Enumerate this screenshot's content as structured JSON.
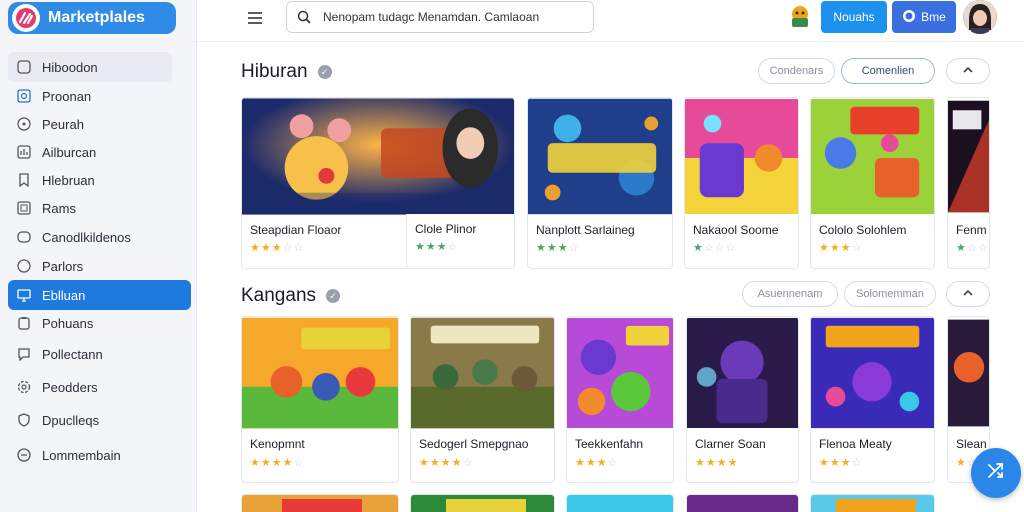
{
  "app": {
    "title": "Marketplales"
  },
  "search": {
    "value": "Nenopam tudagc Menamdan. Camlaoan"
  },
  "header": {
    "notif_label": "Nouahs",
    "user_label": "Bme"
  },
  "sidebar": {
    "items": [
      {
        "label": "Hiboodon",
        "icon": "sliders-icon"
      },
      {
        "label": "Proonan",
        "icon": "box-icon"
      },
      {
        "label": "Peurah",
        "icon": "circle-icon"
      },
      {
        "label": "Ailburcan",
        "icon": "bars-icon"
      },
      {
        "label": "Hlebruan",
        "icon": "bookmark-icon"
      },
      {
        "label": "Rams",
        "icon": "square-icon"
      },
      {
        "label": "Canodlkildenos",
        "icon": "cube-icon"
      },
      {
        "label": "Parlors",
        "icon": "ring-icon"
      },
      {
        "label": "Eblluan",
        "icon": "monitor-icon",
        "active": true
      },
      {
        "label": "Pohuans",
        "icon": "clipboard-icon"
      },
      {
        "label": "Pollectann",
        "icon": "chat-icon"
      },
      {
        "label": "Peodders",
        "icon": "gear-icon"
      },
      {
        "label": "Dpuclleqs",
        "icon": "shield-icon"
      },
      {
        "label": "Lommembain",
        "icon": "minus-circle-icon"
      }
    ]
  },
  "sections": [
    {
      "title": "Hiburan",
      "filter1": "Condenars",
      "filter2": "Comenlien",
      "cards": [
        {
          "name": "Steapdian Floaor",
          "rating": 3,
          "star_color": "gold"
        },
        {
          "name": "Clole Plinor",
          "rating": 3,
          "star_color": "green"
        },
        {
          "name": "Nanplott Sarlaineg",
          "rating": 3,
          "star_color": "green"
        },
        {
          "name": "Nakaool Soome",
          "rating": 1,
          "star_color": "green"
        },
        {
          "name": "Cololo Solohlem",
          "rating": 3,
          "star_color": "gold"
        },
        {
          "name": "Fenm",
          "rating": 1,
          "star_color": "green"
        }
      ]
    },
    {
      "title": "Kangans",
      "filter1": "Asuennenam",
      "filter2": "Solomemman",
      "cards": [
        {
          "name": "Kenopmnt",
          "rating": 4,
          "star_color": "gold"
        },
        {
          "name": "Sedogerl Smepgnao",
          "rating": 4,
          "star_color": "gold"
        },
        {
          "name": "Teekkenfahn",
          "rating": 3,
          "star_color": "gold"
        },
        {
          "name": "Clarner Soan",
          "rating": 4,
          "star_color": "gold"
        },
        {
          "name": "Flenoa Meaty",
          "rating": 3,
          "star_color": "gold"
        },
        {
          "name": "Slean",
          "rating": 1,
          "star_color": "gold"
        }
      ]
    }
  ],
  "colors": {
    "accent": "#1f7ae0",
    "brand": "#2f8be6",
    "button": "#1e90ee"
  }
}
